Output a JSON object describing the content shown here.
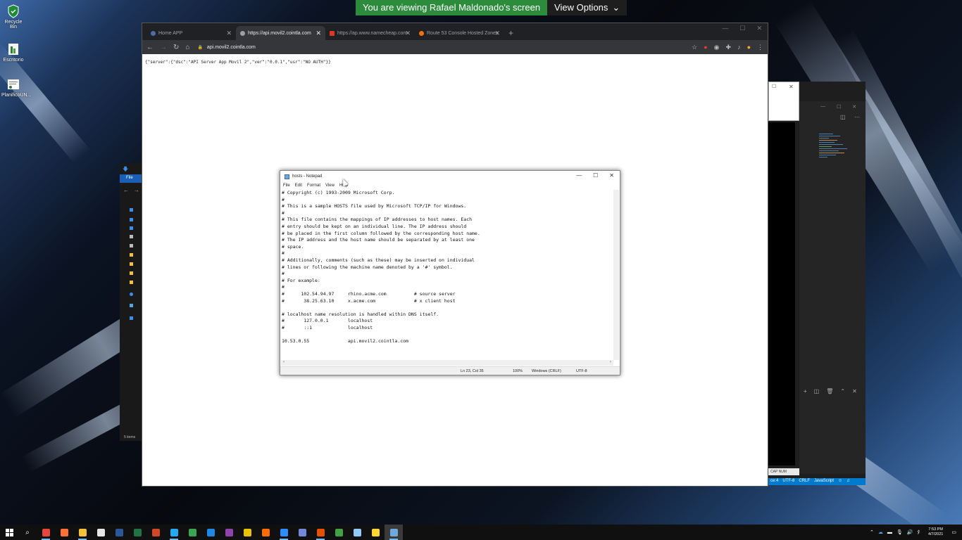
{
  "share_banner": {
    "viewing_text": "You are viewing Rafael Maldonado's screen",
    "view_options_label": "View Options"
  },
  "desktop_icons": [
    {
      "label": "Recycle Bin",
      "icon": "recycle-bin-icon"
    },
    {
      "label": "Escritorio",
      "icon": "folder-icon"
    },
    {
      "label": "PlanificoUN...",
      "icon": "document-icon"
    }
  ],
  "browser": {
    "tabs": [
      {
        "label": "Home APP",
        "active": false,
        "color": "#4a6fa5"
      },
      {
        "label": "https://api.movil2.cointla.com",
        "active": true,
        "color": "#9aa0a6"
      },
      {
        "label": "https://ap.www.namecheap.com",
        "active": false,
        "color": "#de3723"
      },
      {
        "label": "Route 53 Console Hosted Zones",
        "active": false,
        "color": "#ec7211"
      }
    ],
    "url": "api.movil2.cointla.com",
    "page_text": "{\"server\":{\"dsc\":\"API Server App Movil 2\",\"ver\":\"0.0.1\",\"usr\":\"NO AUTH\"}}"
  },
  "explorer": {
    "file_tab": "File",
    "items_count": "5 items"
  },
  "vscode": {
    "status_items": [
      "ce:4",
      "UTF-8",
      "CRLF",
      "JavaScript"
    ],
    "caps_status": "CAP NUM"
  },
  "notepad": {
    "title": "hosts - Notepad",
    "menu": [
      "File",
      "Edit",
      "Format",
      "View",
      "Help"
    ],
    "content": "# Copyright (c) 1993-2009 Microsoft Corp.\n#\n# This is a sample HOSTS file used by Microsoft TCP/IP for Windows.\n#\n# This file contains the mappings of IP addresses to host names. Each\n# entry should be kept on an individual line. The IP address should\n# be placed in the first column followed by the corresponding host name.\n# The IP address and the host name should be separated by at least one\n# space.\n#\n# Additionally, comments (such as these) may be inserted on individual\n# lines or following the machine name denoted by a '#' symbol.\n#\n# For example:\n#\n#      102.54.94.97     rhino.acme.com          # source server\n#       38.25.63.10     x.acme.com              # x client host\n\n# localhost name resolution is handled within DNS itself.\n#\t127.0.0.1       localhost\n#\t::1             localhost\n\n10.53.0.55              api.movil2.cointla.com",
    "status": {
      "position": "Ln 23, Col 35",
      "zoom": "100%",
      "line_ending": "Windows (CRLF)",
      "encoding": "UTF-8"
    }
  },
  "taskbar": {
    "apps": [
      {
        "name": "chrome",
        "color": "#e8453c",
        "active": true
      },
      {
        "name": "firefox",
        "color": "#ff7139",
        "active": false
      },
      {
        "name": "file-explorer",
        "color": "#f3c13a",
        "active": true
      },
      {
        "name": "store",
        "color": "#e6e6e6",
        "active": false
      },
      {
        "name": "word",
        "color": "#2b579a",
        "active": false
      },
      {
        "name": "excel",
        "color": "#217346",
        "active": false
      },
      {
        "name": "powerpoint",
        "color": "#d24726",
        "active": false
      },
      {
        "name": "vscode",
        "color": "#23a9f2",
        "active": true
      },
      {
        "name": "app-green",
        "color": "#3aa655",
        "active": false
      },
      {
        "name": "app-blue",
        "color": "#1e88e5",
        "active": false
      },
      {
        "name": "app-purple",
        "color": "#8e44ad",
        "active": false
      },
      {
        "name": "app-yellow",
        "color": "#e6c200",
        "active": false
      },
      {
        "name": "app-orange",
        "color": "#ff6d00",
        "active": false
      },
      {
        "name": "zoom",
        "color": "#2d8cff",
        "active": true
      },
      {
        "name": "app-discord",
        "color": "#7289da",
        "active": false
      },
      {
        "name": "app-red",
        "color": "#e65100",
        "active": true
      },
      {
        "name": "app-green2",
        "color": "#43a047",
        "active": false
      },
      {
        "name": "app-cube",
        "color": "#90caf9",
        "active": false
      },
      {
        "name": "app-tools",
        "color": "#fdd835",
        "active": false
      },
      {
        "name": "notepad",
        "color": "#6fa8dc",
        "active": true
      }
    ],
    "time": "7:53 PM",
    "date": "4/7/2021"
  }
}
